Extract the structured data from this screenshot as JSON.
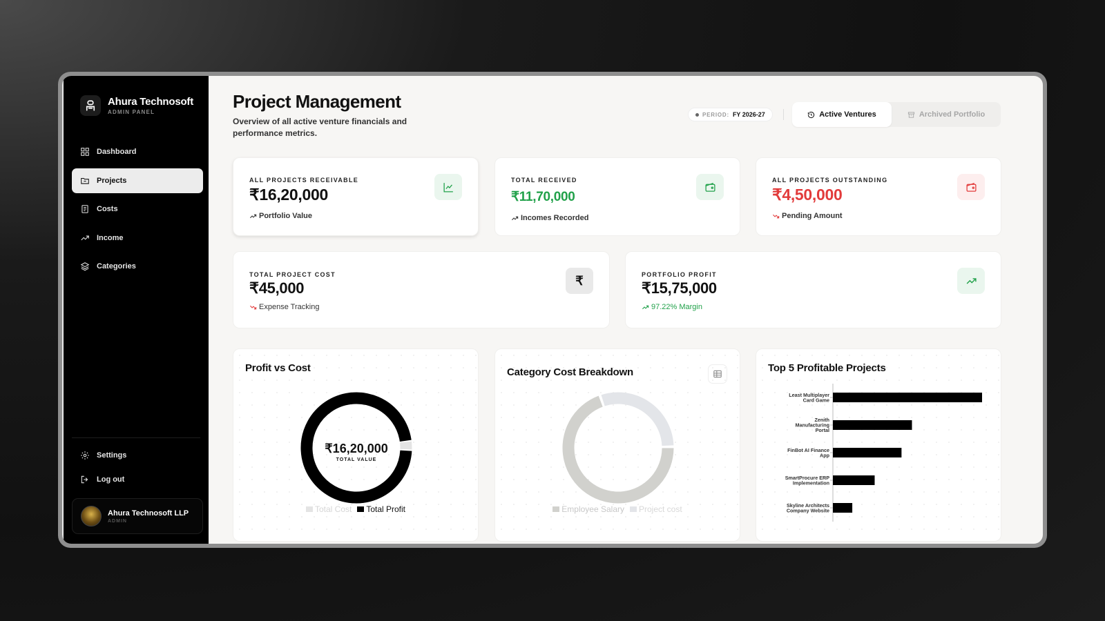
{
  "brand": {
    "name": "Ahura Technosoft",
    "subtitle": "ADMIN PANEL"
  },
  "nav": {
    "items": [
      {
        "label": "Dashboard",
        "icon": "dashboard-icon",
        "active": false
      },
      {
        "label": "Projects",
        "icon": "folder-icon",
        "active": true
      },
      {
        "label": "Costs",
        "icon": "receipt-icon",
        "active": false
      },
      {
        "label": "Income",
        "icon": "trending-up-icon",
        "active": false
      },
      {
        "label": "Categories",
        "icon": "layers-icon",
        "active": false
      }
    ],
    "bottom": [
      {
        "label": "Settings",
        "icon": "gear-icon"
      },
      {
        "label": "Log out",
        "icon": "logout-icon"
      }
    ]
  },
  "user": {
    "name": "Ahura Technosoft LLP",
    "role": "ADMIN"
  },
  "header": {
    "title": "Project Management",
    "subtitle": "Overview of all active venture financials and performance metrics.",
    "period_label": "PERIOD:",
    "period_value": "FY 2026-27",
    "tab_active": "Active Ventures",
    "tab_archived": "Archived Portfolio"
  },
  "stats": {
    "receivable": {
      "label": "ALL PROJECTS RECEIVABLE",
      "value": "₹16,20,000",
      "note": "Portfolio Value"
    },
    "received": {
      "label": "TOTAL RECEIVED",
      "value": "₹11,70,000",
      "note": "Incomes Recorded"
    },
    "outstanding": {
      "label": "ALL PROJECTS OUTSTANDING",
      "value": "₹4,50,000",
      "note": "Pending Amount"
    },
    "cost": {
      "label": "TOTAL PROJECT COST",
      "value": "₹45,000",
      "note": "Expense Tracking"
    },
    "profit": {
      "label": "PORTFOLIO PROFIT",
      "value": "₹15,75,000",
      "note": "97.22% Margin"
    }
  },
  "colors": {
    "green": "#21a14a",
    "red": "#e23b3b",
    "black": "#000000",
    "light_gray": "#e6e6e6"
  },
  "chart_data": [
    {
      "type": "pie",
      "title": "Profit vs Cost",
      "center_value": "₹16,20,000",
      "center_label": "TOTAL VALUE",
      "series": [
        {
          "name": "Total Cost",
          "value": 45000,
          "color": "#e4e4e4"
        },
        {
          "name": "Total Profit",
          "value": 1575000,
          "color": "#000000"
        }
      ]
    },
    {
      "type": "pie",
      "title": "Category Cost Breakdown",
      "series": [
        {
          "name": "Employee Salary",
          "value": 70,
          "color": "#d1d1cd"
        },
        {
          "name": "Project cost",
          "value": 30,
          "color": "#e3e5e9"
        }
      ]
    },
    {
      "type": "bar",
      "orientation": "horizontal",
      "title": "Top 5 Profitable Projects",
      "categories": [
        [
          "Least Multiplayer",
          "Card Game"
        ],
        [
          "Zenith",
          "Manufacturing",
          "Portal"
        ],
        [
          "FinBot AI Finance",
          "App"
        ],
        [
          "SmartProcure ERP",
          "Implementation"
        ],
        [
          "Skyline Architects",
          "Company Website"
        ]
      ],
      "values": [
        100,
        53,
        46,
        28,
        13
      ]
    }
  ]
}
